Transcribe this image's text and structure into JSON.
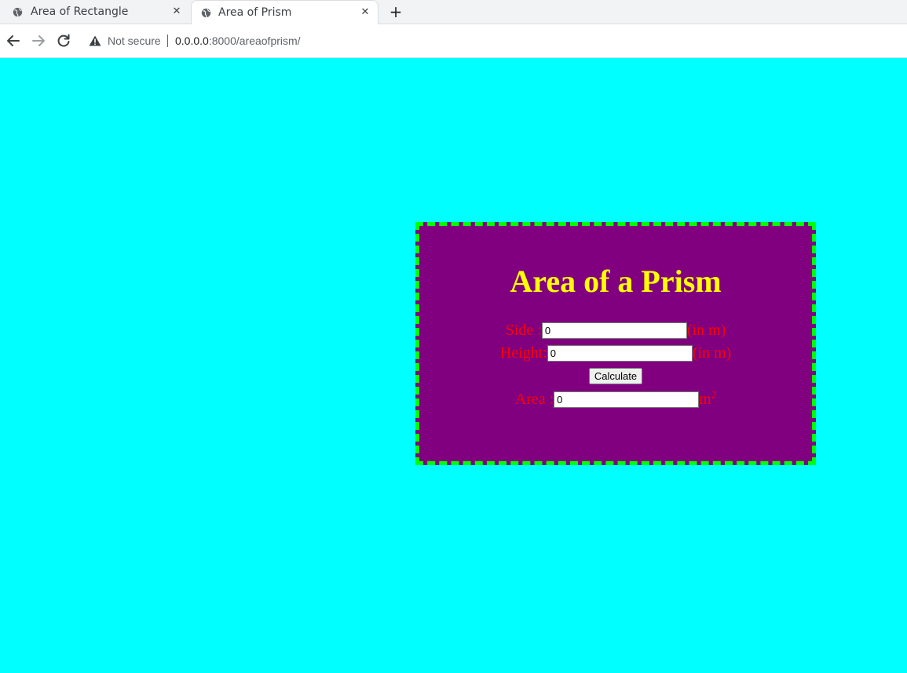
{
  "browser": {
    "tabs": [
      {
        "title": "Area of Rectangle",
        "active": false,
        "icon": "globe-icon"
      },
      {
        "title": "Area of Prism",
        "active": true,
        "icon": "globe-icon"
      }
    ],
    "security_label": "Not secure",
    "url_host": "0.0.0.0",
    "url_rest": ":8000/areaofprism/"
  },
  "page": {
    "background_color": "#00ffff",
    "card_background": "#800080",
    "card_border_color": "#00ff00",
    "title_color": "#ffff00",
    "label_color": "#ff0000",
    "title": "Area of a Prism",
    "side": {
      "label": "Side :",
      "value": "0",
      "unit": "(in m)"
    },
    "height": {
      "label": "Height:",
      "value": "0",
      "unit": "(in m)"
    },
    "calculate_label": "Calculate",
    "area": {
      "label": "Area :",
      "value": "0",
      "unit": "m",
      "unit_exponent": "2"
    }
  }
}
